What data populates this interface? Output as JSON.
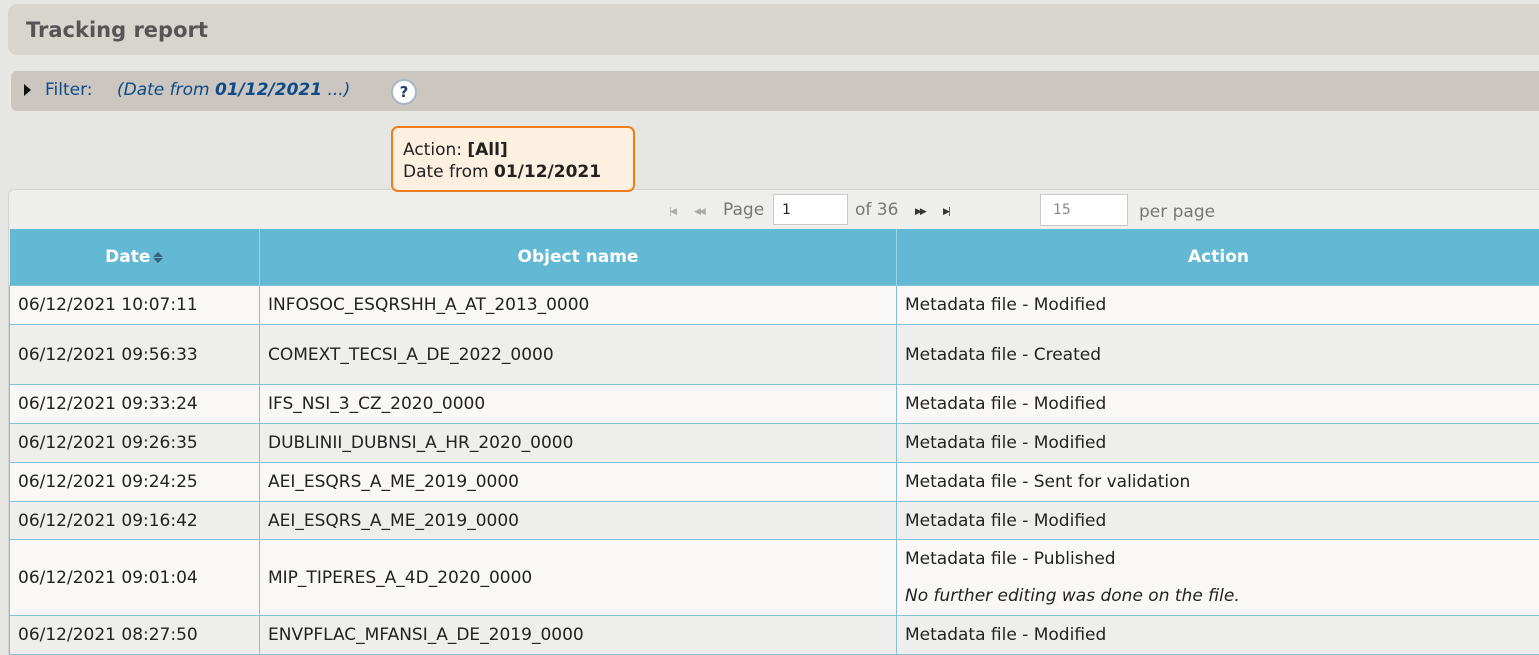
{
  "header": {
    "title": "Tracking report"
  },
  "filter": {
    "label": "Filter:",
    "summary_prefix": "(Date from ",
    "summary_date": "01/12/2021",
    "summary_suffix": " ...)",
    "help_label": "?"
  },
  "tooltip": {
    "action_label": "Action:",
    "action_value": "[All]",
    "date_label": "Date from",
    "date_value": "01/12/2021"
  },
  "pagination": {
    "page_label": "Page",
    "current_page": "1",
    "of_label": "of 36",
    "per_page_value": "15",
    "per_page_label": "per page"
  },
  "table": {
    "columns": [
      "Date",
      "Object name",
      "Action"
    ],
    "rows": [
      {
        "date": "06/12/2021 10:07:11",
        "object": "INFOSOC_ESQRSHH_A_AT_2013_0000",
        "action": "Metadata file - Modified"
      },
      {
        "date": "06/12/2021 09:56:33",
        "object": "COMEXT_TECSI_A_DE_2022_0000",
        "action": "Metadata file - Created"
      },
      {
        "date": "06/12/2021 09:33:24",
        "object": "IFS_NSI_3_CZ_2020_0000",
        "action": "Metadata file - Modified"
      },
      {
        "date": "06/12/2021 09:26:35",
        "object": "DUBLINII_DUBNSI_A_HR_2020_0000",
        "action": "Metadata file - Modified"
      },
      {
        "date": "06/12/2021 09:24:25",
        "object": "AEI_ESQRS_A_ME_2019_0000",
        "action": "Metadata file - Sent for validation"
      },
      {
        "date": "06/12/2021 09:16:42",
        "object": "AEI_ESQRS_A_ME_2019_0000",
        "action": "Metadata file - Modified"
      },
      {
        "date": "06/12/2021 09:01:04",
        "object": "MIP_TIPERES_A_4D_2020_0000",
        "action": "Metadata file - Published",
        "note": "No further editing was done on the file."
      },
      {
        "date": "06/12/2021 08:27:50",
        "object": "ENVPFLAC_MFANSI_A_DE_2019_0000",
        "action": "Metadata file - Modified"
      }
    ]
  }
}
